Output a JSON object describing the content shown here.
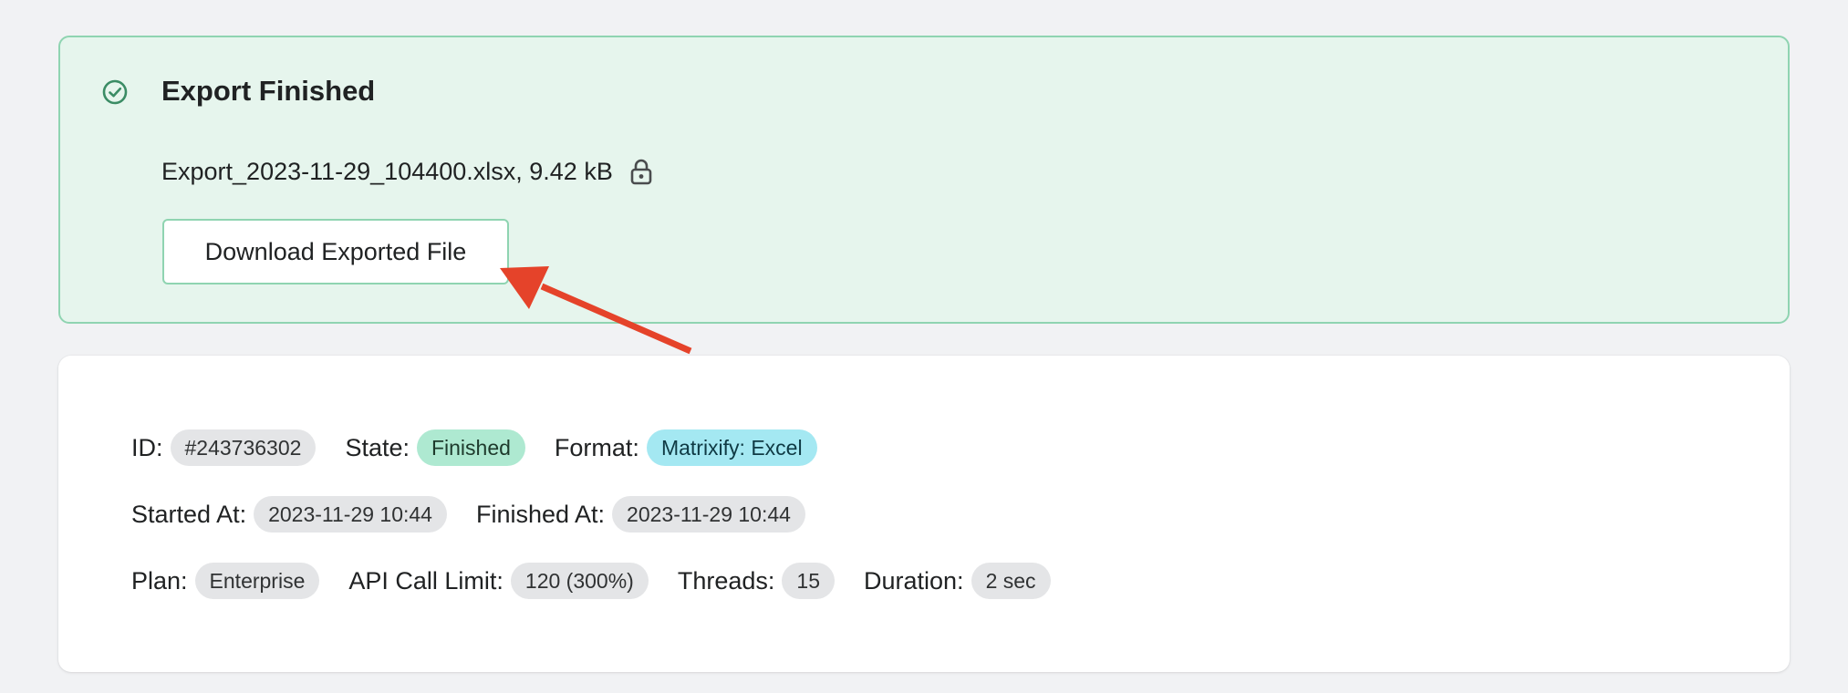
{
  "banner": {
    "title": "Export Finished",
    "icon": "check-circle-icon",
    "file_info": "Export_2023-11-29_104400.xlsx, 9.42 kB",
    "lock_icon": "lock-icon",
    "download_label": "Download Exported File",
    "colors": {
      "background": "#e6f5ed",
      "border": "#8fd4b1",
      "icon": "#3b8c65"
    }
  },
  "annotation": {
    "arrow_color": "#e5432a"
  },
  "details": {
    "id": {
      "label": "ID:",
      "value": "#243736302"
    },
    "state": {
      "label": "State:",
      "value": "Finished",
      "color": "#aee9d1"
    },
    "format": {
      "label": "Format:",
      "value": "Matrixify: Excel",
      "color": "#a4e8f2"
    },
    "started_at": {
      "label": "Started At:",
      "value": "2023-11-29 10:44"
    },
    "finished_at": {
      "label": "Finished At:",
      "value": "2023-11-29 10:44"
    },
    "plan": {
      "label": "Plan:",
      "value": "Enterprise"
    },
    "api_call_limit": {
      "label": "API Call Limit:",
      "value": "120 (300%)"
    },
    "threads": {
      "label": "Threads:",
      "value": "15"
    },
    "duration": {
      "label": "Duration:",
      "value": "2 sec"
    }
  }
}
